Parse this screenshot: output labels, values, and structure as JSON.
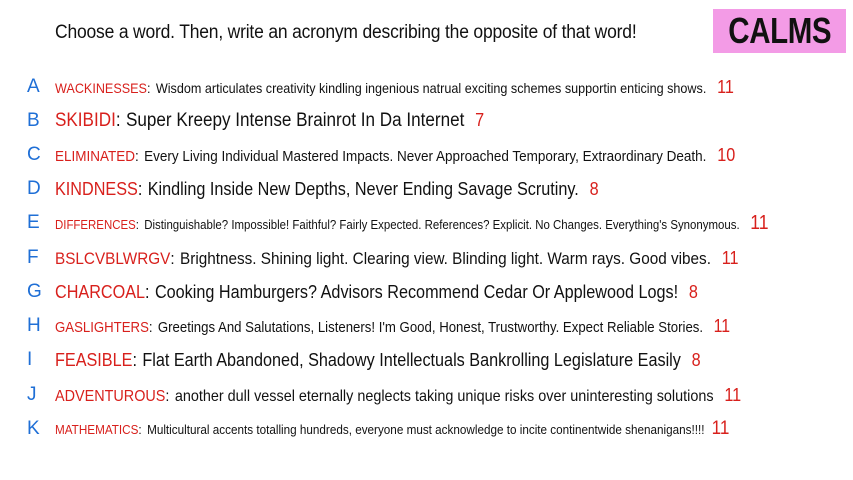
{
  "prompt": "Choose a word. Then, write an acronym describing the opposite of that word!",
  "badge": "CALMS",
  "rows": [
    {
      "letter": "A",
      "word": "WACKINESSES",
      "acronym": "Wisdom articulates creativity kindling ingenious natrual exciting schemes supportin enticing shows.",
      "count": "11"
    },
    {
      "letter": "B",
      "word": "SKIBIDI",
      "acronym": "Super Kreepy Intense Brainrot In Da Internet",
      "count": "7"
    },
    {
      "letter": "C",
      "word": "ELIMINATED",
      "acronym": "Every Living Individual Mastered Impacts. Never Approached Temporary, Extraordinary Death.",
      "count": "10"
    },
    {
      "letter": "D",
      "word": "KINDNESS",
      "acronym": "Kindling Inside New Depths, Never Ending Savage Scrutiny.",
      "count": "8"
    },
    {
      "letter": "E",
      "word": "DIFFERENCES",
      "acronym": "Distinguishable? Impossible! Faithful? Fairly Expected. References? Explicit. No Changes. Everything's Synonymous.",
      "count": "11"
    },
    {
      "letter": "F",
      "word": "BSLCVBLWRGV",
      "acronym": "Brightness. Shining light. Clearing view. Blinding light. Warm rays. Good vibes.",
      "count": "11"
    },
    {
      "letter": "G",
      "word": "CHARCOAL",
      "acronym": "Cooking Hamburgers? Advisors Recommend Cedar Or Applewood Logs!",
      "count": "8"
    },
    {
      "letter": "H",
      "word": "GASLIGHTERS",
      "acronym": "Greetings And Salutations, Listeners! I'm Good, Honest, Trustworthy. Expect Reliable Stories.",
      "count": "11"
    },
    {
      "letter": "I",
      "word": "FEASIBLE",
      "acronym": "Flat Earth Abandoned, Shadowy Intellectuals Bankrolling Legislature Easily",
      "count": "8"
    },
    {
      "letter": "J",
      "word": "ADVENTUROUS",
      "acronym": "another dull vessel eternally neglects taking unique risks over uninteresting solutions",
      "count": "11"
    },
    {
      "letter": "K",
      "word": "MATHEMATICS",
      "acronym": "Multicultural accents totalling hundreds, everyone must acknowledge to incite continentwide shenanigans!!!!",
      "count": "11"
    }
  ]
}
